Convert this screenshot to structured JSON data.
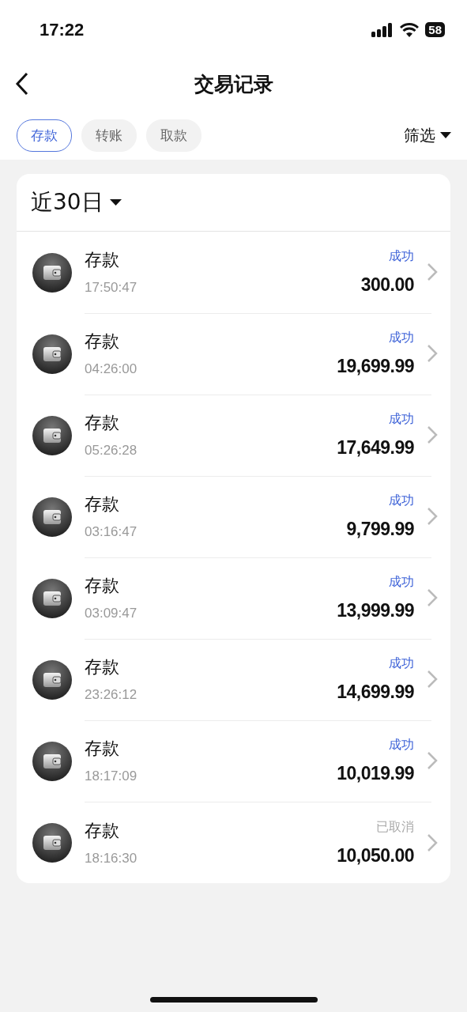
{
  "status_bar": {
    "time": "17:22",
    "battery": "58"
  },
  "nav": {
    "title": "交易记录"
  },
  "tabs": [
    {
      "label": "存款",
      "selected": true
    },
    {
      "label": "转账",
      "selected": false
    },
    {
      "label": "取款",
      "selected": false
    }
  ],
  "filter": {
    "label": "筛选"
  },
  "period": {
    "label": "近30日"
  },
  "transactions": [
    {
      "type": "存款",
      "time": "17:50:47",
      "status": "成功",
      "kind": "success",
      "amount": "300.00"
    },
    {
      "type": "存款",
      "time": "04:26:00",
      "status": "成功",
      "kind": "success",
      "amount": "19,699.99"
    },
    {
      "type": "存款",
      "time": "05:26:28",
      "status": "成功",
      "kind": "success",
      "amount": "17,649.99"
    },
    {
      "type": "存款",
      "time": "03:16:47",
      "status": "成功",
      "kind": "success",
      "amount": "9,799.99"
    },
    {
      "type": "存款",
      "time": "03:09:47",
      "status": "成功",
      "kind": "success",
      "amount": "13,999.99"
    },
    {
      "type": "存款",
      "time": "23:26:12",
      "status": "成功",
      "kind": "success",
      "amount": "14,699.99"
    },
    {
      "type": "存款",
      "time": "18:17:09",
      "status": "成功",
      "kind": "success",
      "amount": "10,019.99"
    },
    {
      "type": "存款",
      "time": "18:16:30",
      "status": "已取消",
      "kind": "cancelled",
      "amount": "10,050.00"
    }
  ]
}
